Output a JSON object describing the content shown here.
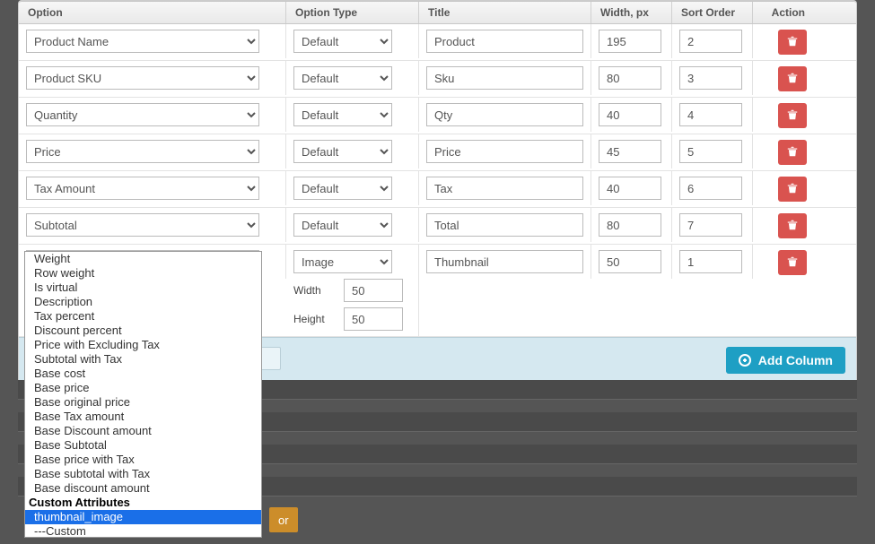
{
  "headers": {
    "option": "Option",
    "optionType": "Option Type",
    "title": "Title",
    "width": "Width, px",
    "sort": "Sort Order",
    "action": "Action"
  },
  "rows": [
    {
      "option": "Product Name",
      "type": "Default",
      "title": "Product",
      "width": "195",
      "sort": "2"
    },
    {
      "option": "Product SKU",
      "type": "Default",
      "title": "Sku",
      "width": "80",
      "sort": "3"
    },
    {
      "option": "Quantity",
      "type": "Default",
      "title": "Qty",
      "width": "40",
      "sort": "4"
    },
    {
      "option": "Price",
      "type": "Default",
      "title": "Price",
      "width": "45",
      "sort": "5"
    },
    {
      "option": "Tax Amount",
      "type": "Default",
      "title": "Tax",
      "width": "40",
      "sort": "6"
    },
    {
      "option": "Subtotal",
      "type": "Default",
      "title": "Total",
      "width": "80",
      "sort": "7"
    },
    {
      "option": "thumbnail_image",
      "type": "Image",
      "title": "Thumbnail",
      "width": "50",
      "sort": "1",
      "dims": {
        "widthLabel": "Width",
        "heightLabel": "Height",
        "widthVal": "50",
        "heightVal": "50"
      }
    }
  ],
  "footer": {
    "addColumn": "Add Column"
  },
  "dropdown": {
    "items": [
      {
        "label": "Weight"
      },
      {
        "label": "Row weight"
      },
      {
        "label": "Is virtual"
      },
      {
        "label": "Description"
      },
      {
        "label": "Tax percent"
      },
      {
        "label": "Discount percent"
      },
      {
        "label": "Price with Excluding Tax"
      },
      {
        "label": "Subtotal with Tax"
      },
      {
        "label": "Base cost"
      },
      {
        "label": "Base price"
      },
      {
        "label": "Base original price"
      },
      {
        "label": "Base Tax amount"
      },
      {
        "label": "Base Discount amount"
      },
      {
        "label": "Base Subtotal"
      },
      {
        "label": "Base price with Tax"
      },
      {
        "label": "Base subtotal with Tax"
      },
      {
        "label": "Base discount amount"
      },
      {
        "label": "Custom Attributes",
        "group": true
      },
      {
        "label": "thumbnail_image",
        "selected": true
      },
      {
        "label": "---Custom"
      }
    ]
  },
  "belowEditor": {
    "truncated": "or"
  }
}
